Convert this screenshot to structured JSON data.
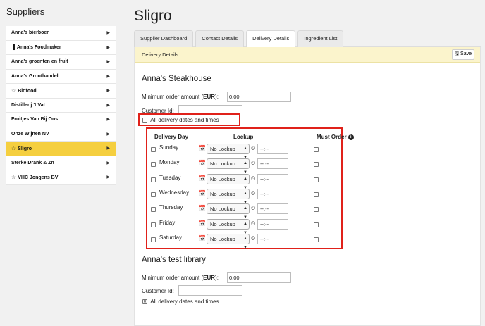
{
  "sidebar": {
    "title": "Suppliers",
    "items": [
      {
        "label": "Anna's bierboer",
        "prefix": ""
      },
      {
        "label": "Anna's Foodmaker",
        "prefix": "▐"
      },
      {
        "label": "Anna's groenten en fruit",
        "prefix": ""
      },
      {
        "label": "Anna's Groothandel",
        "prefix": ""
      },
      {
        "label": "Bidfood",
        "prefix": "☆"
      },
      {
        "label": "Distillerij 't Vat",
        "prefix": ""
      },
      {
        "label": "Fruitjes Van Bij Ons",
        "prefix": ""
      },
      {
        "label": "Onze Wijnen NV",
        "prefix": ""
      },
      {
        "label": "Sligro",
        "prefix": "☆"
      },
      {
        "label": "Sterke Drank & Zn",
        "prefix": ""
      },
      {
        "label": "VHC Jongens BV",
        "prefix": "☆"
      }
    ],
    "active_index": 8
  },
  "page": {
    "title": "Sligro"
  },
  "tabs": [
    "Supplier Dashboard",
    "Contact Details",
    "Delivery Details",
    "Ingredient List"
  ],
  "active_tab": 2,
  "card": {
    "header": "Delivery Details",
    "save_label": "Save"
  },
  "library1": {
    "title": "Anna's Steakhouse",
    "min_order_prefix": "Minimum order amount (",
    "min_order_currency": "EUR",
    "min_order_suffix": "):",
    "min_order_value": "0,00",
    "customer_id_label": "Customer Id:",
    "customer_id_value": "",
    "all_dates_label": "All delivery dates and times",
    "table": {
      "col_day": "Delivery Day",
      "col_lockup": "Lockup",
      "col_must": "Must Order",
      "rows": [
        {
          "day": "Sunday",
          "lockup": "No Lockup",
          "time": "--:--"
        },
        {
          "day": "Monday",
          "lockup": "No Lockup",
          "time": "--:--"
        },
        {
          "day": "Tuesday",
          "lockup": "No Lockup",
          "time": "--:--"
        },
        {
          "day": "Wednesday",
          "lockup": "No Lockup",
          "time": "--:--"
        },
        {
          "day": "Thursday",
          "lockup": "No Lockup",
          "time": "--:--"
        },
        {
          "day": "Friday",
          "lockup": "No Lockup",
          "time": "--:--"
        },
        {
          "day": "Saturday",
          "lockup": "No Lockup",
          "time": "--:--"
        }
      ]
    }
  },
  "library2": {
    "title": "Anna's test library",
    "min_order_prefix": "Minimum order amount (",
    "min_order_currency": "EUR",
    "min_order_suffix": "):",
    "min_order_value": "0,00",
    "customer_id_label": "Customer Id:",
    "customer_id_value": "",
    "all_dates_label": "All delivery dates and times",
    "all_dates_checked": true
  },
  "colors": {
    "accent": "#f5cf3f",
    "highlight": "#e0211a",
    "header_bg": "#fbf4cc"
  }
}
